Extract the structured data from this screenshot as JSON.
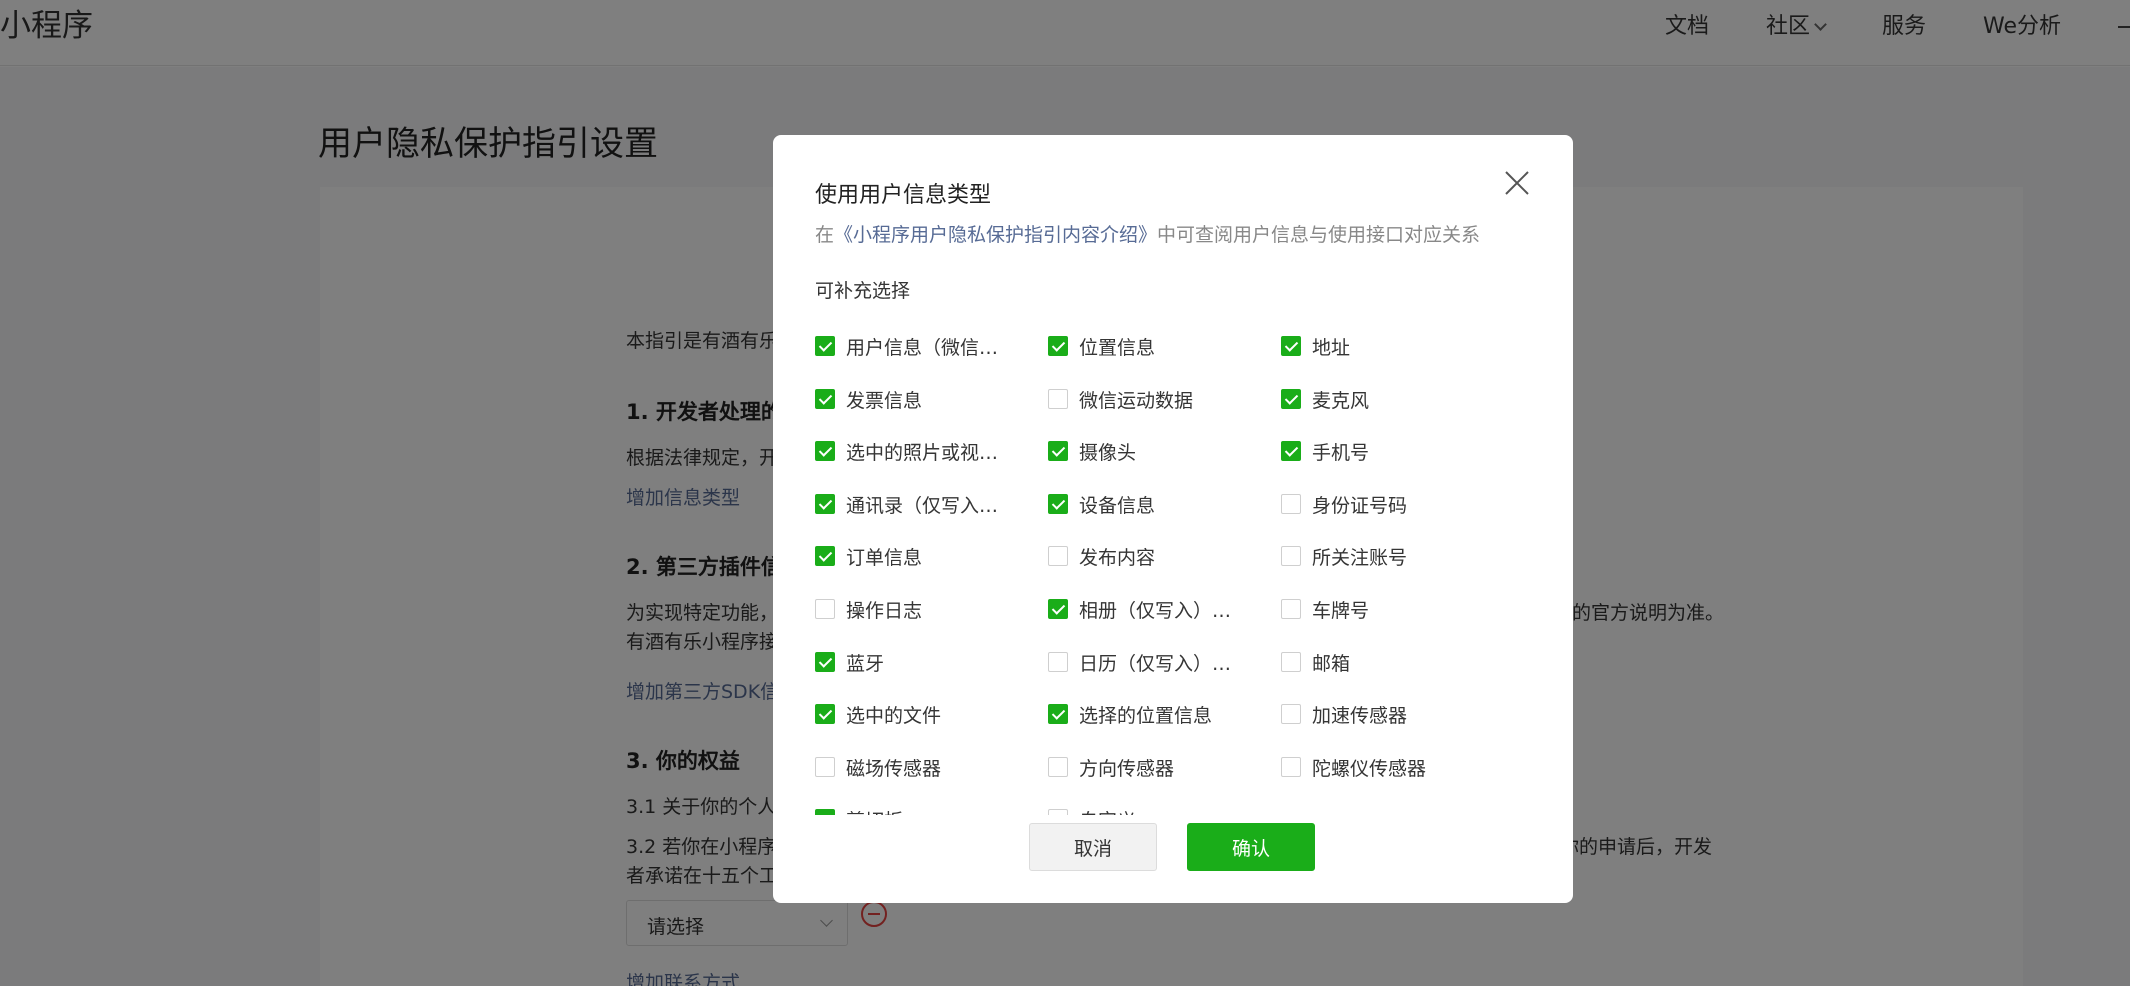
{
  "header": {
    "brand": "小程序",
    "nav": [
      {
        "label": "文档",
        "dropdown": false
      },
      {
        "label": "社区",
        "dropdown": true
      },
      {
        "label": "服务",
        "dropdown": false
      },
      {
        "label": "We分析",
        "dropdown": false
      }
    ]
  },
  "page": {
    "title": "用户隐私保护指引设置",
    "intro": "本指引是有酒有乐",
    "sec1_title": "1. 开发者处理的",
    "sec1_text": "根据法律规定，开",
    "sec1_link": "增加信息类型",
    "sec2_title": "2. 第三方插件信",
    "sec2_text_a": "为实现特定功能，",
    "sec2_text_a_tail": "的官方说明为准。",
    "sec2_text_b": "有酒有乐小程序接",
    "sec2_link": "增加第三方SDK信",
    "sec3_title": "3. 你的权益",
    "sec3_1": "3.1  关于你的个人",
    "sec3_2": "3.2  若你在小程序",
    "sec3_2_tail": "你的申请后，开发",
    "sec3_2b": "者承诺在十五个工",
    "select_placeholder": "请选择",
    "contact_link": "增加联系方式"
  },
  "dialog": {
    "title": "使用用户信息类型",
    "subtitle_prefix": "在",
    "subtitle_link": "《小程序用户隐私保护指引内容介绍》",
    "subtitle_suffix": "中可查阅用户信息与使用接口对应关系",
    "section": "可补充选择",
    "options": [
      {
        "label": "用户信息（微信昵称、头像）",
        "checked": true
      },
      {
        "label": "位置信息",
        "checked": true
      },
      {
        "label": "地址",
        "checked": true
      },
      {
        "label": "发票信息",
        "checked": true
      },
      {
        "label": "微信运动数据",
        "checked": false
      },
      {
        "label": "麦克风",
        "checked": true
      },
      {
        "label": "选中的照片或视频信息",
        "checked": true
      },
      {
        "label": "摄像头",
        "checked": true
      },
      {
        "label": "手机号",
        "checked": true
      },
      {
        "label": "通讯录（仅写入）权限",
        "checked": true
      },
      {
        "label": "设备信息",
        "checked": true
      },
      {
        "label": "身份证号码",
        "checked": false
      },
      {
        "label": "订单信息",
        "checked": true
      },
      {
        "label": "发布内容",
        "checked": false
      },
      {
        "label": "所关注账号",
        "checked": false
      },
      {
        "label": "操作日志",
        "checked": false
      },
      {
        "label": "相册（仅写入）权限",
        "checked": true
      },
      {
        "label": "车牌号",
        "checked": false
      },
      {
        "label": "蓝牙",
        "checked": true
      },
      {
        "label": "日历（仅写入）权限",
        "checked": false
      },
      {
        "label": "邮箱",
        "checked": false
      },
      {
        "label": "选中的文件",
        "checked": true
      },
      {
        "label": "选择的位置信息",
        "checked": true
      },
      {
        "label": "加速传感器",
        "checked": false
      },
      {
        "label": "磁场传感器",
        "checked": false
      },
      {
        "label": "方向传感器",
        "checked": false
      },
      {
        "label": "陀螺仪传感器",
        "checked": false
      },
      {
        "label": "剪切板",
        "checked": true
      },
      {
        "label": "自定义",
        "checked": false
      }
    ],
    "cancel_label": "取消",
    "confirm_label": "确认",
    "colors": {
      "accent": "#1aad19",
      "link": "#576b95"
    }
  }
}
